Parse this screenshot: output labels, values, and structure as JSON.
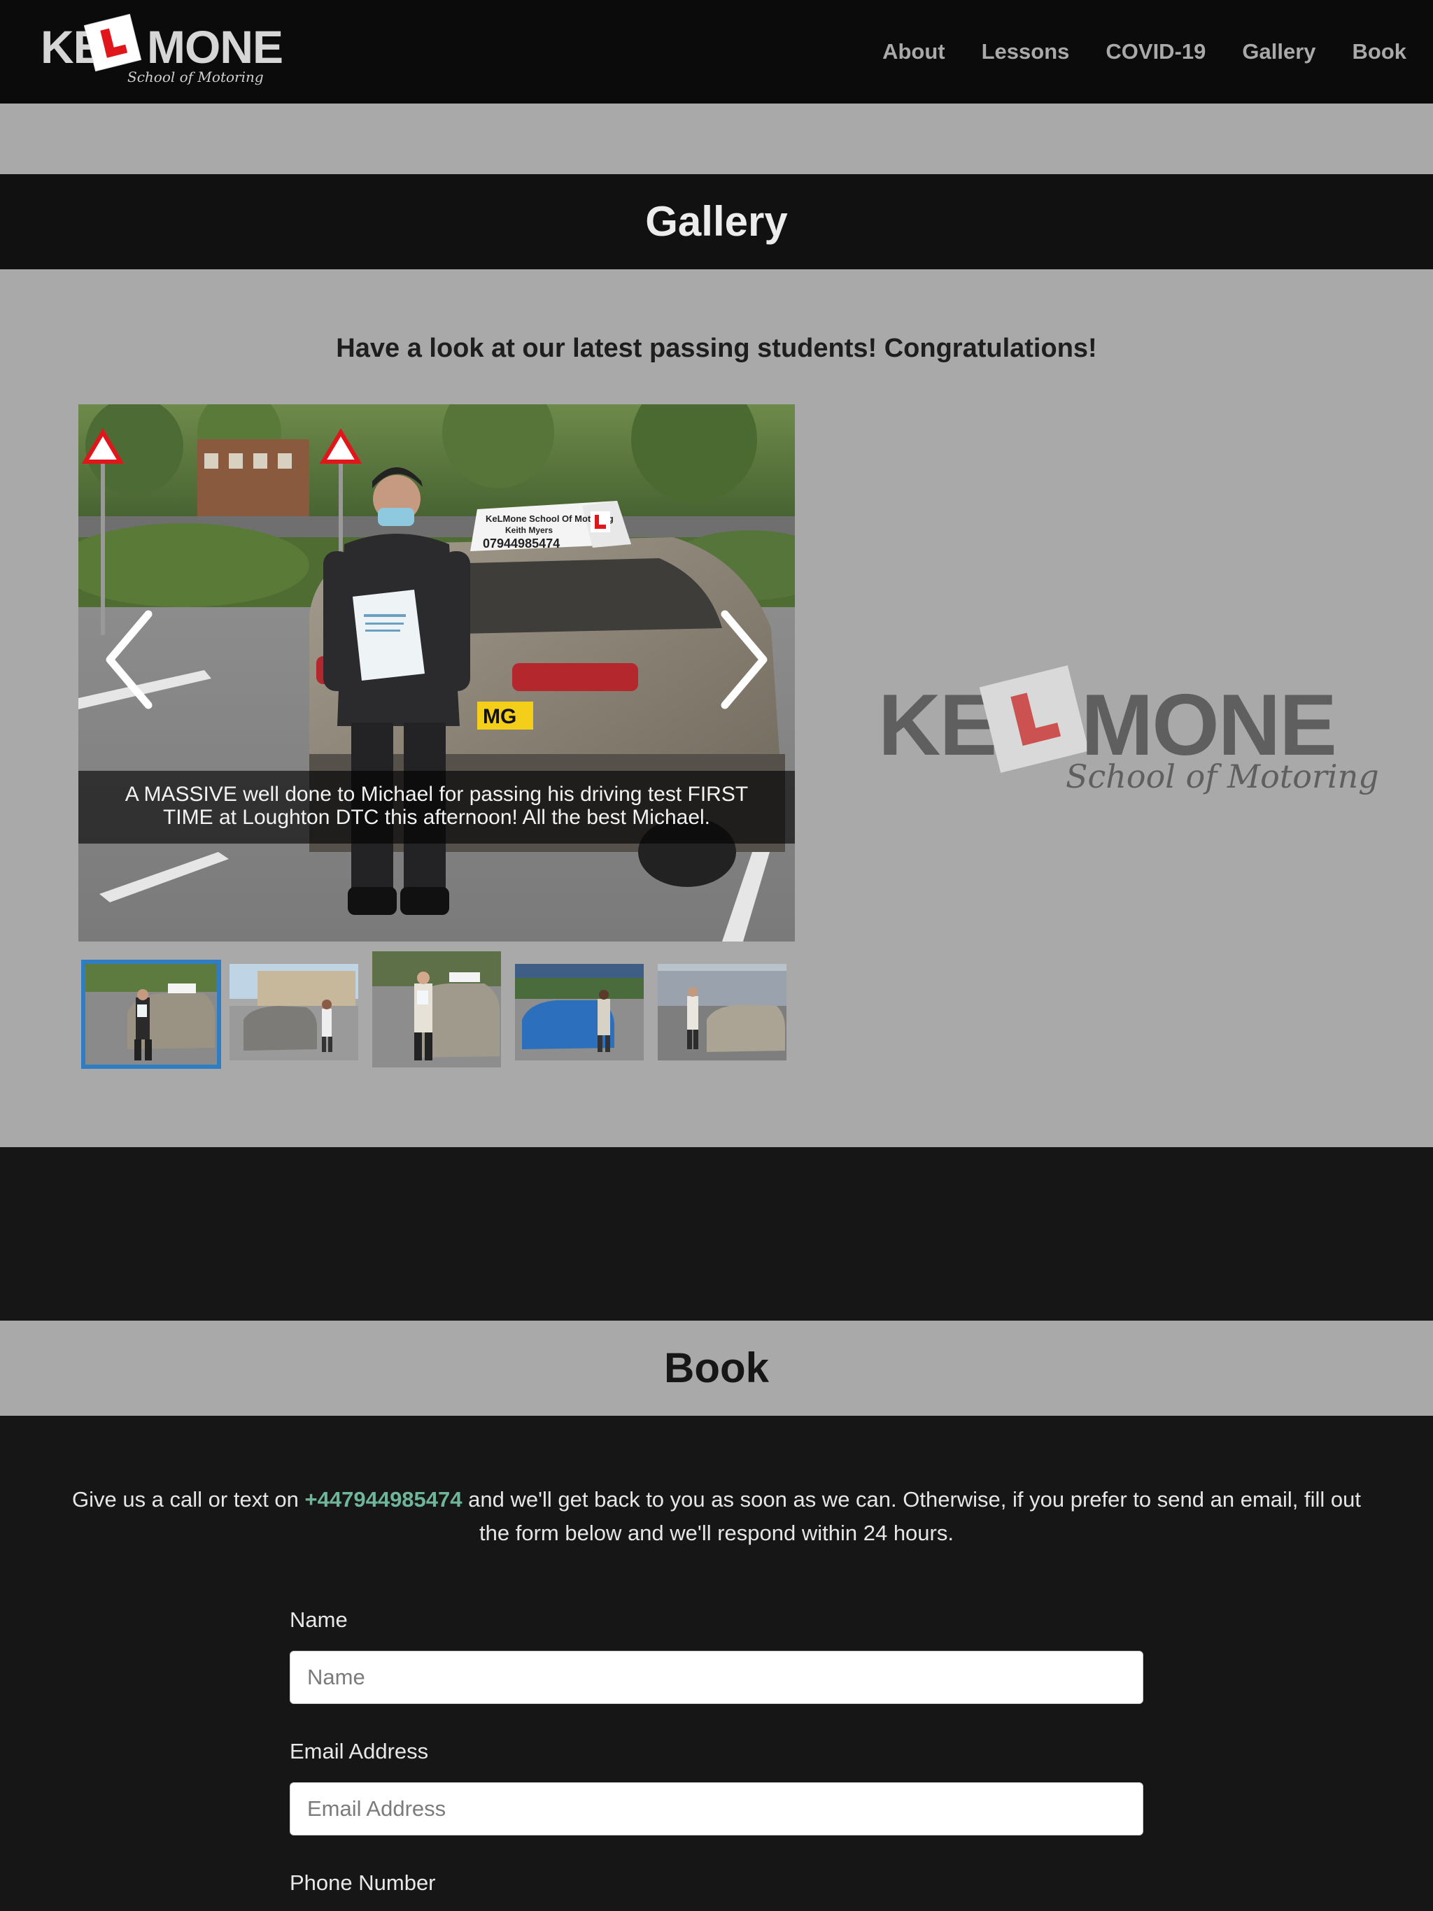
{
  "nav": {
    "brand": {
      "left": "KE",
      "right": "MONE",
      "script": "School of Motoring"
    },
    "items": [
      {
        "label": "About"
      },
      {
        "label": "Lessons"
      },
      {
        "label": "COVID-19"
      },
      {
        "label": "Gallery"
      },
      {
        "label": "Book"
      }
    ]
  },
  "gallery": {
    "title": "Gallery",
    "subtitle": "Have a look at our latest passing students! Congratulations!",
    "slide": {
      "caption": "A MASSIVE well done to Michael for passing his driving test FIRST TIME at Loughton DTC this afternoon! All the best Michael.",
      "roof_sign_line1": "KeLMone School Of Motoring",
      "roof_sign_line2": "Keith Myers",
      "roof_sign_line3": "07944985474",
      "plate_text": "MG"
    },
    "thumbnails_count": 5,
    "active_thumbnail": 1,
    "logo": {
      "left": "KE",
      "right": "MONE",
      "script": "School of Motoring"
    }
  },
  "book": {
    "title": "Book",
    "intro_before": "Give us a call or text on ",
    "phone": "+447944985474",
    "intro_after": " and we'll get back to you as soon as we can. Otherwise, if you prefer to send an email, fill out the form below and we'll respond within 24 hours.",
    "fields": {
      "name": {
        "label": "Name",
        "placeholder": "Name"
      },
      "email": {
        "label": "Email Address",
        "placeholder": "Email Address"
      },
      "phone": {
        "label": "Phone Number"
      }
    }
  },
  "colors": {
    "nav_bg": "#0b0b0b",
    "section_grey": "#a9a9a9",
    "dark_bg": "#161616",
    "accent_phone": "#6fb599",
    "thumb_active_border": "#2f7dc3",
    "learner_red": "#e1161b"
  }
}
